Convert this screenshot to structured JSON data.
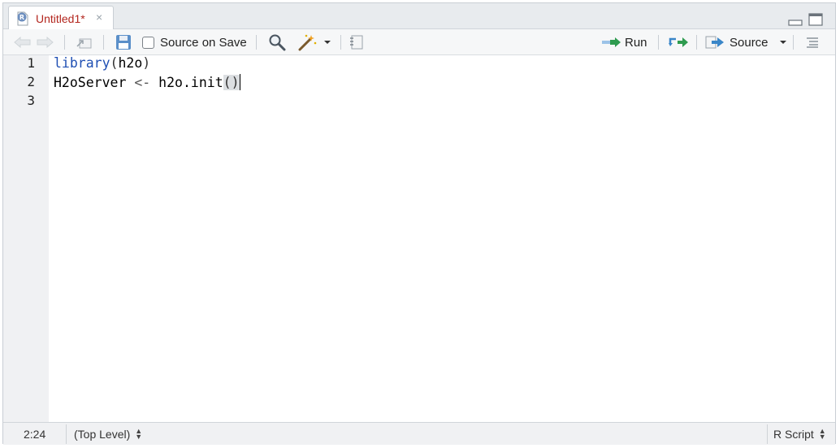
{
  "tab": {
    "title": "Untitled1*",
    "close_label": "×"
  },
  "toolbar": {
    "source_on_save_label": "Source on Save",
    "run_label": "Run",
    "source_label": "Source"
  },
  "editor": {
    "line_numbers": [
      "1",
      "2",
      "3"
    ],
    "lines": [
      {
        "keyword": "library",
        "open": "(",
        "arg": "h2o",
        "close": ")"
      },
      {
        "var": "H2oServer",
        "assign": "<-",
        "fn": "h2o.init",
        "open": "(",
        "close": ")"
      },
      {
        "text": ""
      }
    ]
  },
  "statusbar": {
    "cursor_position": "2:24",
    "scope": "(Top Level)",
    "file_type": "R Script"
  },
  "colors": {
    "tab_title": "#b3261e",
    "keyword": "#1f4fb3",
    "run_arrow": "#2e9b4f",
    "source_arrow": "#3a86c8"
  }
}
